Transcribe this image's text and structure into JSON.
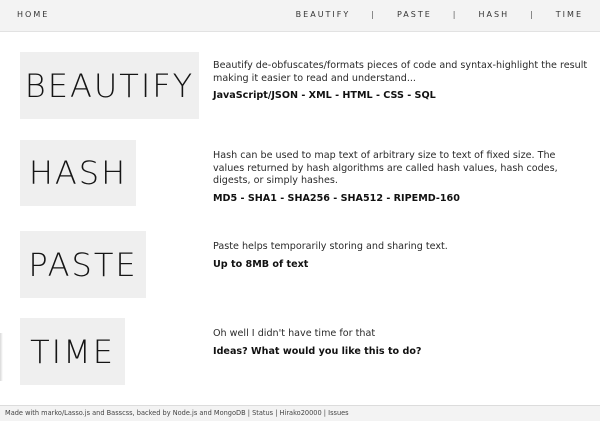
{
  "nav": {
    "home": "HOME",
    "links": [
      "BEAUTIFY",
      "PASTE",
      "HASH",
      "TIME"
    ],
    "separator": "|"
  },
  "sections": [
    {
      "title": "BEAUTIFY",
      "text": "Beautify de-obfuscates/formats pieces of code and syntax-highlight the result making it easier to read and understand...",
      "strong": "JavaScript/JSON - XML - HTML - CSS - SQL"
    },
    {
      "title": "HASH",
      "text": "Hash can be used to map text of arbitrary size to text of fixed size. The values returned by hash algorithms are called hash values, hash codes, digests, or simply hashes.",
      "strong": "MD5 - SHA1 - SHA256 - SHA512 - RIPEMD-160"
    },
    {
      "title": "PASTE",
      "text": "Paste helps temporarily storing and sharing text.",
      "strong": "Up to 8MB of text"
    },
    {
      "title": "TIME",
      "text": "Oh well I didn't have time for that",
      "strong": "Ideas? What would you like this to do?"
    }
  ],
  "footer": {
    "prefix": "Made with marko/Lasso.js and Basscss, backed by Node.js and MongoDB",
    "sep": "|",
    "status": "Status",
    "author": "Hirako20000",
    "issues": "Issues"
  }
}
